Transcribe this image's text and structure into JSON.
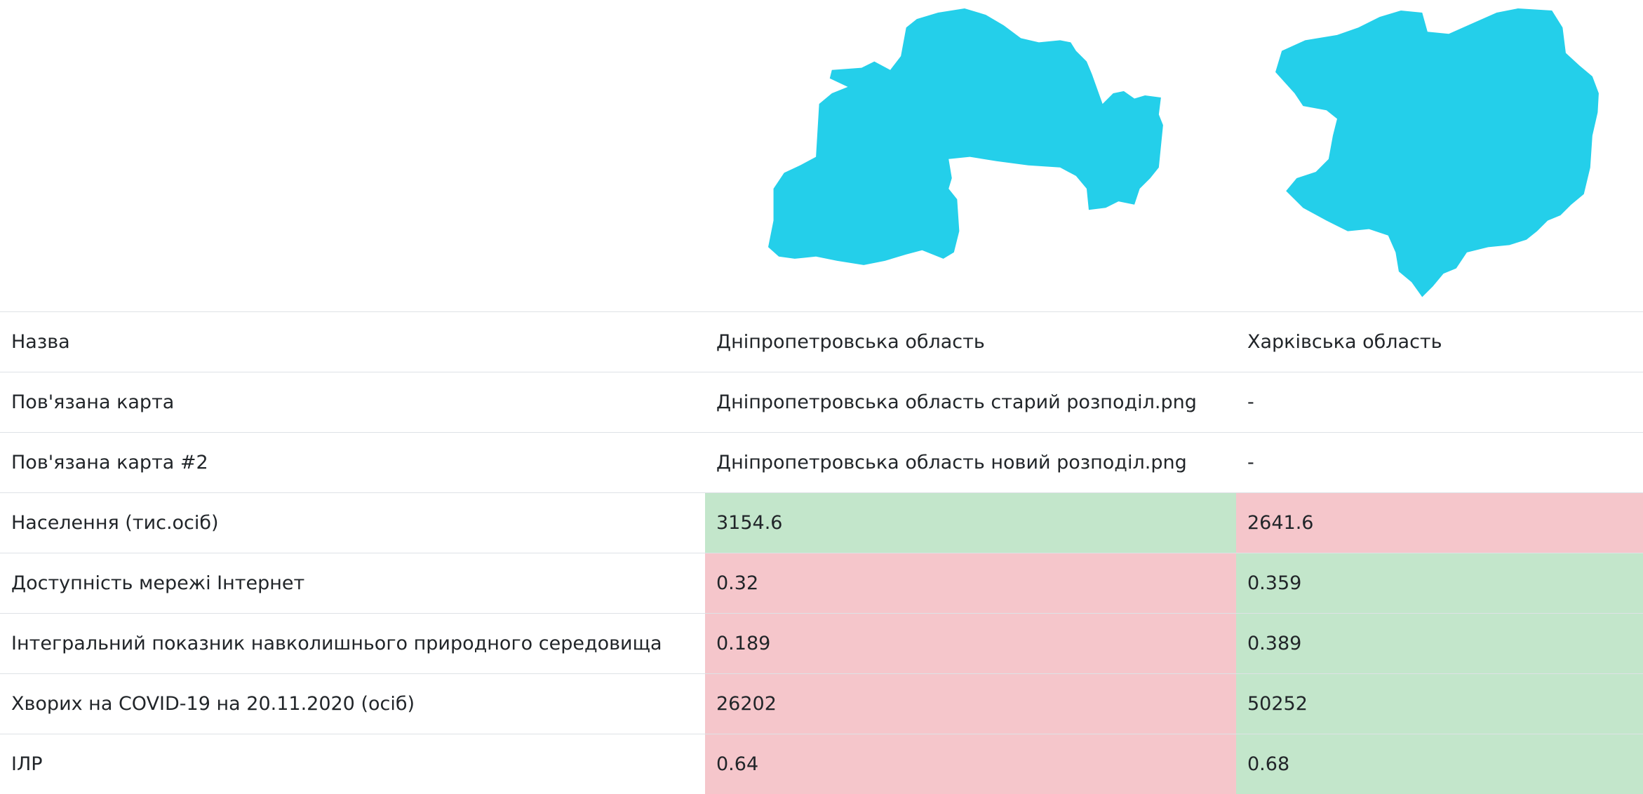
{
  "colors": {
    "map_fill": "#24cfea",
    "better_cell": "#c3e6cb",
    "worse_cell": "#f5c6cb",
    "border": "#dee2e6"
  },
  "maps": [
    {
      "icon": "dnipropetrovsk-oblast-map"
    },
    {
      "icon": "kharkiv-oblast-map"
    }
  ],
  "rows": [
    {
      "label": "Назва",
      "a": "Дніпропетровська область",
      "b": "Харківська область",
      "a_status": "",
      "b_status": ""
    },
    {
      "label": "Пов'язана карта",
      "a": "Дніпропетровська область старий розподіл.png",
      "b": "-",
      "a_status": "",
      "b_status": ""
    },
    {
      "label": "Пов'язана карта #2",
      "a": "Дніпропетровська область новий розподіл.png",
      "b": "-",
      "a_status": "",
      "b_status": ""
    },
    {
      "label": "Населення (тис.осіб)",
      "a": "3154.6",
      "b": "2641.6",
      "a_status": "better",
      "b_status": "worse"
    },
    {
      "label": "Доступність мережі Інтернет",
      "a": "0.32",
      "b": "0.359",
      "a_status": "worse",
      "b_status": "better"
    },
    {
      "label": "Інтегральний показник навколишнього природного середовища",
      "a": "0.189",
      "b": "0.389",
      "a_status": "worse",
      "b_status": "better"
    },
    {
      "label": "Хворих на COVID-19 на 20.11.2020 (осіб)",
      "a": "26202",
      "b": "50252",
      "a_status": "worse",
      "b_status": "better"
    },
    {
      "label": "ІЛР",
      "a": "0.64",
      "b": "0.68",
      "a_status": "worse",
      "b_status": "better"
    }
  ]
}
